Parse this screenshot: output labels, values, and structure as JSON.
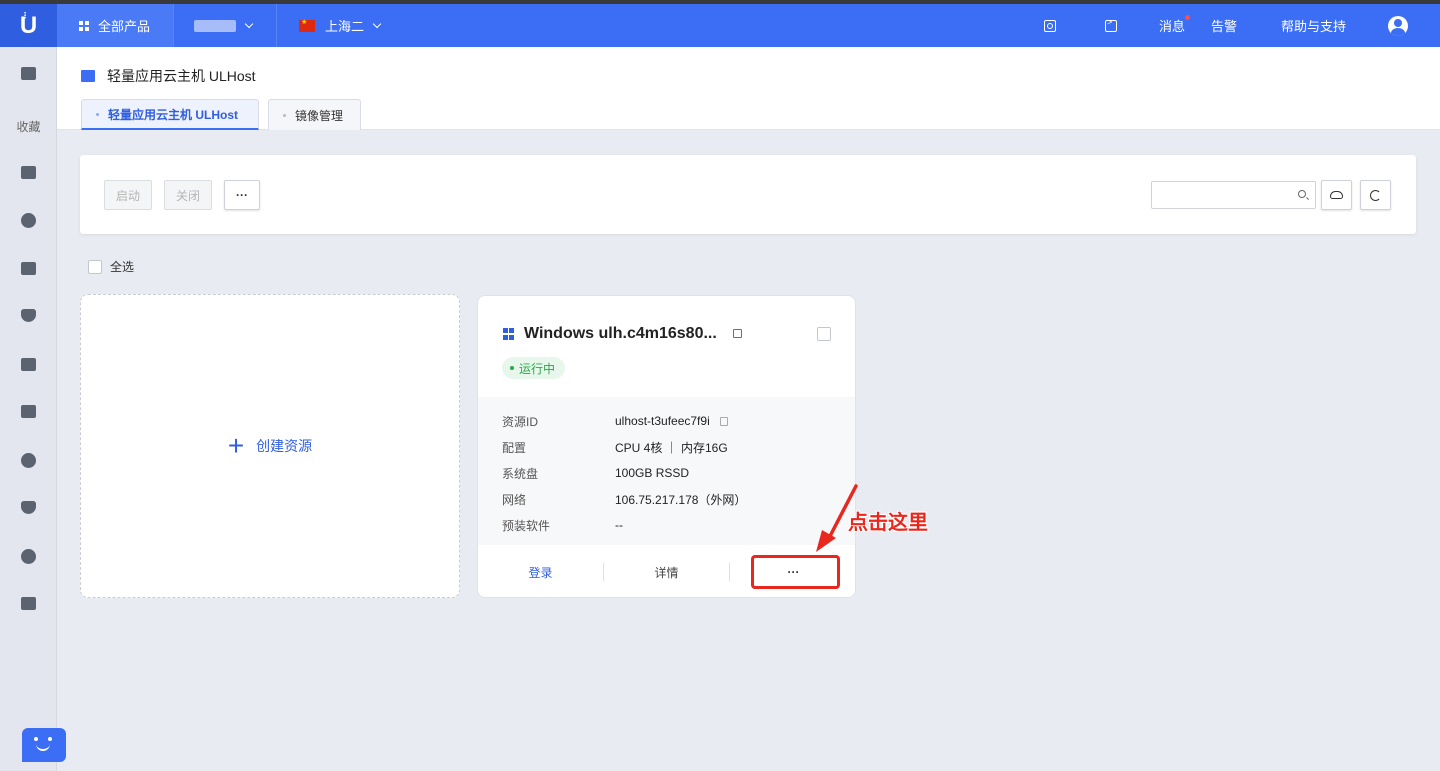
{
  "topbar": {
    "logo": "U",
    "products_label": "全部产品",
    "region_label": "上海二",
    "links": [
      "消息",
      "告警",
      "帮助与支持"
    ]
  },
  "sidebar": {
    "favorites_label": "收藏"
  },
  "header": {
    "title": "轻量应用云主机 ULHost",
    "tabs": [
      {
        "label": "轻量应用云主机 ULHost",
        "active": true
      },
      {
        "label": "镜像管理",
        "active": false
      }
    ]
  },
  "toolbar": {
    "start_label": "启动",
    "stop_label": "关闭",
    "more_label": "···",
    "search_placeholder": ""
  },
  "select_all_label": "全选",
  "create_card": {
    "plus": "+",
    "label": "创建资源"
  },
  "resource_card": {
    "name": "Windows ulh.c4m16s80...",
    "status": "运行中",
    "fields": [
      {
        "key": "资源ID",
        "value": "ulhost-t3ufeec7f9i"
      },
      {
        "key": "配置",
        "value": "CPU 4核 ｜ 内存16G"
      },
      {
        "key": "系统盘",
        "value": "100GB RSSD"
      },
      {
        "key": "网络",
        "value": "106.75.217.178（外网）"
      },
      {
        "key": "预装软件",
        "value": "--"
      }
    ],
    "actions": {
      "login": "登录",
      "detail": "详情",
      "more": "···"
    }
  },
  "annotation": {
    "text": "点击这里",
    "color": "#e8281e"
  },
  "colors": {
    "brand": "#3b6ef4",
    "running": "#2aa84a"
  }
}
